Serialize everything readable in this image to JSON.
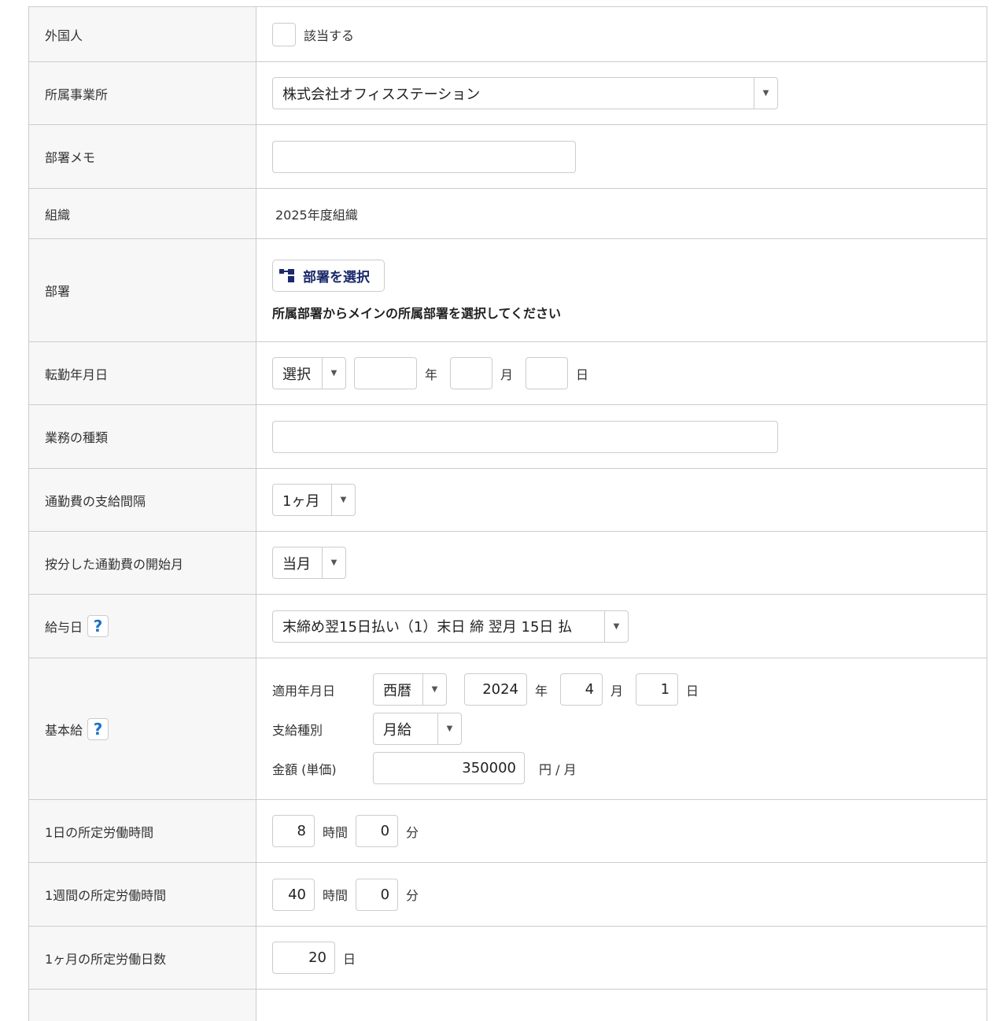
{
  "foreigner": {
    "label": "外国人",
    "checkbox": "該当する"
  },
  "office": {
    "label": "所属事業所",
    "value": "株式会社オフィスステーション"
  },
  "dept_memo": {
    "label": "部署メモ",
    "value": ""
  },
  "org": {
    "label": "組織",
    "value": "2025年度組織"
  },
  "dept": {
    "label": "部署",
    "button": "部署を選択",
    "note": "所属部署からメインの所属部署を選択してください"
  },
  "transfer": {
    "label": "転勤年月日",
    "era": "選択",
    "year": "",
    "month": "",
    "day": "",
    "u_year": "年",
    "u_month": "月",
    "u_day": "日"
  },
  "job_type": {
    "label": "業務の種類",
    "value": ""
  },
  "commute_interval": {
    "label": "通勤費の支給間隔",
    "value": "1ヶ月"
  },
  "commute_start": {
    "label": "按分した通勤費の開始月",
    "value": "当月"
  },
  "payday": {
    "label": "給与日",
    "value": "末締め翌15日払い（1）末日 締 翌月 15日 払"
  },
  "base_salary": {
    "label": "基本給",
    "date_label": "適用年月日",
    "era": "西暦",
    "year": "2024",
    "month": "4",
    "day": "1",
    "u_year": "年",
    "u_month": "月",
    "u_day": "日",
    "type_label": "支給種別",
    "type": "月給",
    "amount_label": "金額 (単価)",
    "amount": "350000",
    "amount_unit": "円 / 月"
  },
  "daily_hours": {
    "label": "1日の所定労働時間",
    "hours": "8",
    "minutes": "0",
    "u_h": "時間",
    "u_m": "分"
  },
  "weekly_hours": {
    "label": "1週間の所定労働時間",
    "hours": "40",
    "minutes": "0",
    "u_h": "時間",
    "u_m": "分"
  },
  "monthly_days": {
    "label": "1ヶ月の所定労働日数",
    "days": "20",
    "u_d": "日"
  },
  "help": "?"
}
